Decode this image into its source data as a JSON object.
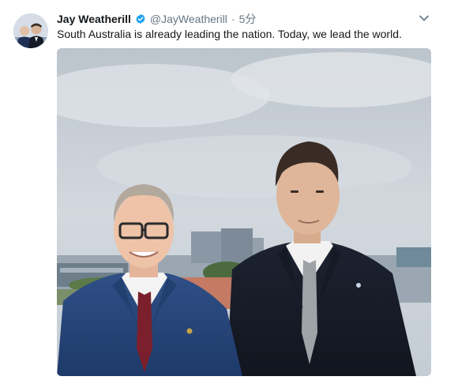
{
  "tweet": {
    "author_name": "Jay Weatherill",
    "handle": "@JayWeatherill",
    "separator": "·",
    "timestamp": "5分",
    "text": "South Australia is already leading the nation. Today, we lead the world."
  },
  "icons": {
    "avatar": "profile-photo",
    "verified": "verified-badge-icon",
    "menu": "chevron-down-icon"
  },
  "colors": {
    "name": "#14171a",
    "secondary": "#657786",
    "verified": "#1da1f2"
  }
}
